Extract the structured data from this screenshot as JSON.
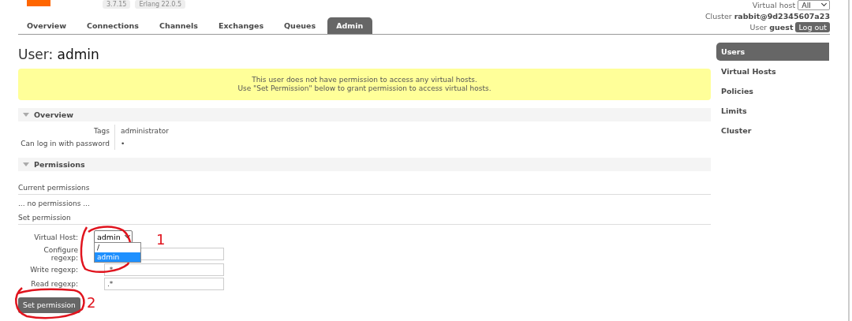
{
  "header": {
    "version": "3.7.15",
    "erlang": "Erlang 22.0.5",
    "vhost_label": "Virtual host",
    "vhost_value": "All",
    "cluster_label": "Cluster",
    "cluster_name": "rabbit@9d2345607a23",
    "user_label": "User",
    "user_name": "guest",
    "logout": "Log out"
  },
  "tabs": [
    {
      "label": "Overview",
      "selected": false
    },
    {
      "label": "Connections",
      "selected": false
    },
    {
      "label": "Channels",
      "selected": false
    },
    {
      "label": "Exchanges",
      "selected": false
    },
    {
      "label": "Queues",
      "selected": false
    },
    {
      "label": "Admin",
      "selected": true
    }
  ],
  "title": {
    "prefix": "User:",
    "name": "admin"
  },
  "warning": [
    "This user does not have permission to access any virtual hosts.",
    "Use \"Set Permission\" below to grant permission to access virtual hosts."
  ],
  "overview": {
    "heading": "Overview",
    "rows": [
      {
        "label": "Tags",
        "value": "administrator"
      },
      {
        "label": "Can log in with password",
        "value": "•"
      }
    ]
  },
  "permissions": {
    "heading": "Permissions",
    "current_heading": "Current permissions",
    "empty": "... no permissions ...",
    "set_heading": "Set permission",
    "virtual_host": {
      "label": "Virtual Host:",
      "value": "admin",
      "options": [
        {
          "label": "/",
          "selected": false
        },
        {
          "label": "admin",
          "selected": true
        }
      ]
    },
    "fields": [
      {
        "label": "Configure regexp:"
      },
      {
        "label": "Write regexp:",
        "value": ".*"
      },
      {
        "label": "Read regexp:",
        "value": ".*"
      }
    ],
    "button": "Set permission"
  },
  "sidebar": {
    "items": [
      {
        "label": "Users",
        "selected": true
      },
      {
        "label": "Virtual Hosts",
        "selected": false
      },
      {
        "label": "Policies",
        "selected": false
      },
      {
        "label": "Limits",
        "selected": false
      },
      {
        "label": "Cluster",
        "selected": false
      }
    ]
  },
  "annotations": [
    "1",
    "2"
  ]
}
